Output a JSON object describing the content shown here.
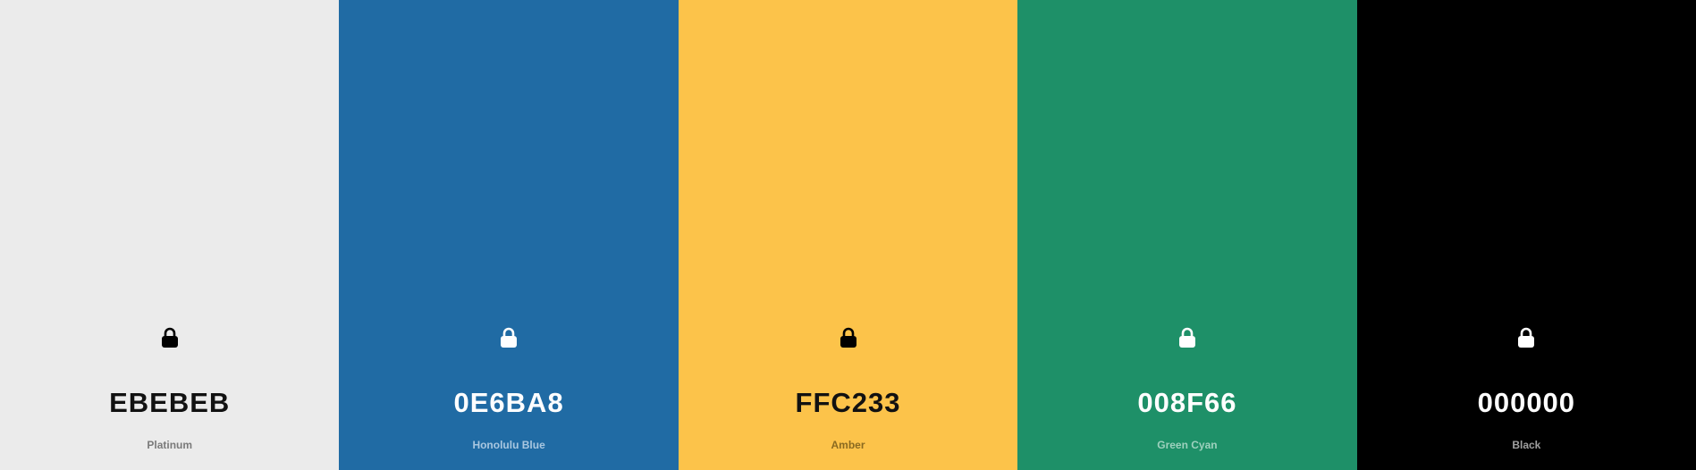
{
  "palette": {
    "swatches": [
      {
        "hex": "EBEBEB",
        "name": "Platinum",
        "color": "#EBEBEB",
        "text_color": "#111111",
        "name_color": "#7a7a7a",
        "lock_color": "#000000",
        "icon": "lock-icon"
      },
      {
        "hex": "0E6BA8",
        "name": "Honolulu Blue",
        "color": "#206BA4",
        "text_color": "#ffffff",
        "name_color": "#a9c7e0",
        "lock_color": "#ffffff",
        "icon": "lock-icon"
      },
      {
        "hex": "FFC233",
        "name": "Amber",
        "color": "#FCC34A",
        "text_color": "#111111",
        "name_color": "#8a6a20",
        "lock_color": "#000000",
        "icon": "lock-icon"
      },
      {
        "hex": "008F66",
        "name": "Green Cyan",
        "color": "#1E9068",
        "text_color": "#ffffff",
        "name_color": "#9ed1be",
        "lock_color": "#ffffff",
        "icon": "lock-icon"
      },
      {
        "hex": "000000",
        "name": "Black",
        "color": "#000000",
        "text_color": "#ffffff",
        "name_color": "#a0a0a0",
        "lock_color": "#ffffff",
        "icon": "lock-icon"
      }
    ]
  }
}
